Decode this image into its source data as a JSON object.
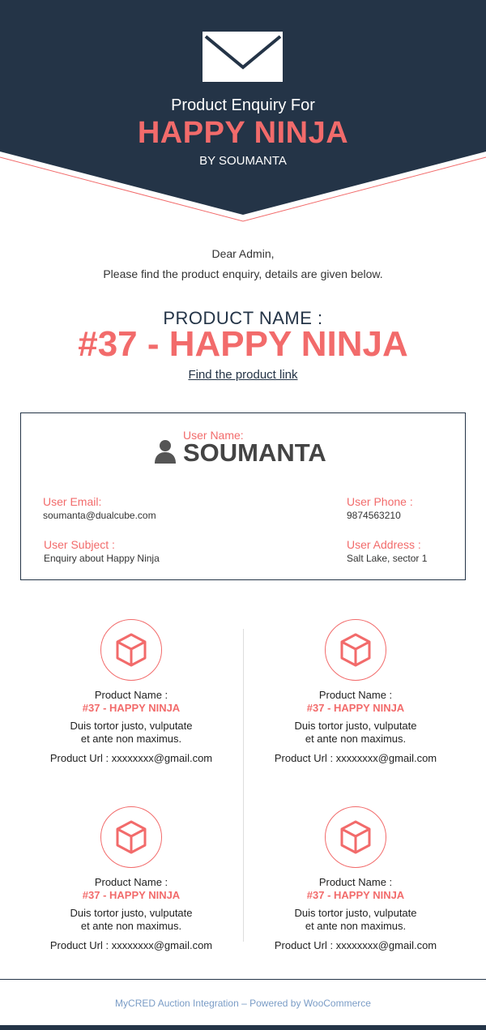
{
  "header": {
    "subtitle": "Product Enquiry For",
    "title": "HAPPY NINJA",
    "byline": "BY SOUMANTA",
    "icon": "envelope-icon",
    "bg_color": "#243447",
    "accent_color": "#f26b6b"
  },
  "greeting": {
    "salutation": "Dear Admin,",
    "message": "Please find the product enquiry, details are given below."
  },
  "product": {
    "label": "PRODUCT NAME :",
    "value": "#37 - HAPPY NINJA",
    "link_text": "Find the product link"
  },
  "user": {
    "name_label": "User Name:",
    "name": "SOUMANTA",
    "email_label": "User Email:",
    "email": "soumanta@dualcube.com",
    "phone_label": "User Phone :",
    "phone": "9874563210",
    "subject_label": "User Subject :",
    "subject": "Enquiry about Happy Ninja",
    "address_label": "User Address :",
    "address": "Salt Lake, sector 1"
  },
  "cards": [
    {
      "label": "Product Name :",
      "value": "#37 - HAPPY NINJA",
      "desc_line1": "Duis tortor justo, vulputate",
      "desc_line2": "et ante non maximus.",
      "url": "Product Url : xxxxxxxx@gmail.com"
    },
    {
      "label": "Product Name :",
      "value": "#37 - HAPPY NINJA",
      "desc_line1": "Duis tortor justo, vulputate",
      "desc_line2": "et ante non maximus.",
      "url": "Product Url : xxxxxxxx@gmail.com"
    },
    {
      "label": "Product Name :",
      "value": "#37 - HAPPY NINJA",
      "desc_line1": "Duis tortor justo, vulputate",
      "desc_line2": "et ante non maximus.",
      "url": "Product Url : xxxxxxxx@gmail.com"
    },
    {
      "label": "Product Name :",
      "value": "#37 - HAPPY NINJA",
      "desc_line1": "Duis tortor justo, vulputate",
      "desc_line2": "et ante non maximus.",
      "url": "Product Url : xxxxxxxx@gmail.com"
    }
  ],
  "footer": {
    "text": "MyCRED Auction Integration – Powered by WooCommerce"
  }
}
